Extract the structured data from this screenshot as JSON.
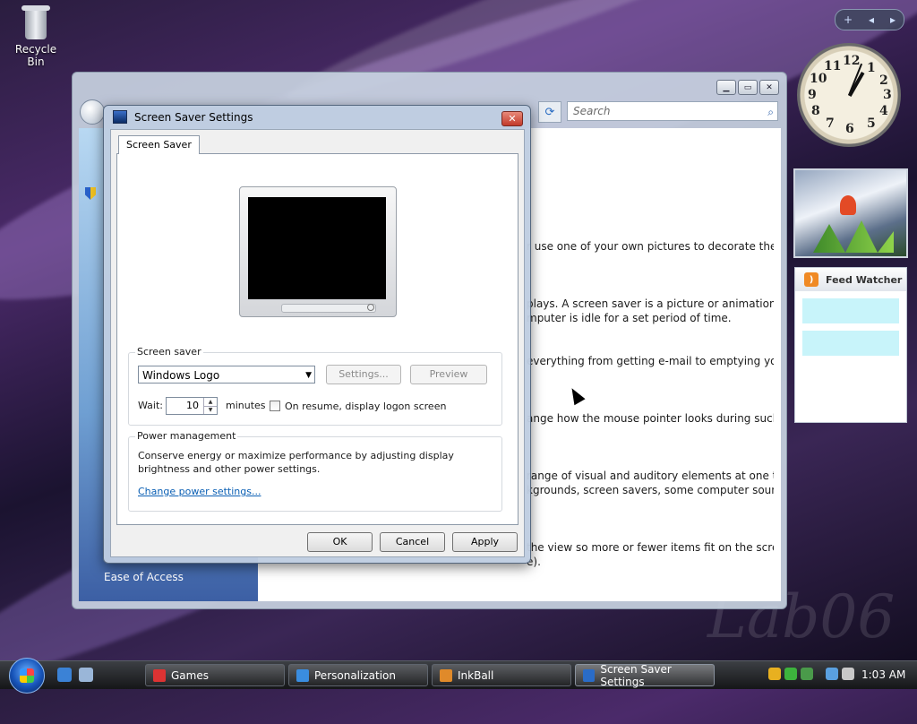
{
  "desktop": {
    "recycle_bin_label": "Recycle Bin",
    "watermark": "Lab06"
  },
  "sidebar": {
    "controls": [
      "+",
      "◂",
      "▸"
    ],
    "clock_numbers": [
      "12",
      "1",
      "2",
      "3",
      "4",
      "5",
      "6",
      "7",
      "8",
      "9",
      "10",
      "11"
    ],
    "feed_watcher": {
      "title": "Feed Watcher"
    }
  },
  "background_window": {
    "search_placeholder": "Search",
    "left_nav_item": "Ease of Access",
    "paragraphs": [
      "r use one of your own pictures to decorate the",
      "plays. A screen saver is a picture or animation that",
      "mputer is idle for a set period of time.",
      "everything from getting e-mail to emptying your",
      "ange how the mouse pointer looks during such",
      "range of visual and auditory elements at one time",
      "kgrounds, screen savers, some computer sounds,",
      " the view so more or fewer items fit on the screen.",
      "e)."
    ]
  },
  "dialog": {
    "title": "Screen Saver Settings",
    "tab": "Screen Saver",
    "screen_saver_group": {
      "label": "Screen saver",
      "selected": "Windows Logo",
      "settings_button": "Settings...",
      "preview_button": "Preview",
      "wait_label": "Wait:",
      "wait_value": "10",
      "minutes_label": "minutes",
      "resume_checkbox_label": "On resume, display logon screen",
      "resume_checked": false
    },
    "power_group": {
      "label": "Power management",
      "description_line1": "Conserve energy or maximize performance by adjusting display",
      "description_line2": "brightness and other power settings.",
      "link": "Change power settings..."
    },
    "buttons": {
      "ok": "OK",
      "cancel": "Cancel",
      "apply": "Apply"
    }
  },
  "taskbar": {
    "items": [
      {
        "label": "Games",
        "active": false
      },
      {
        "label": "Personalization",
        "active": false
      },
      {
        "label": "InkBall",
        "active": false
      },
      {
        "label": "Screen Saver Settings",
        "active": true
      }
    ],
    "clock": "1:03 AM"
  }
}
